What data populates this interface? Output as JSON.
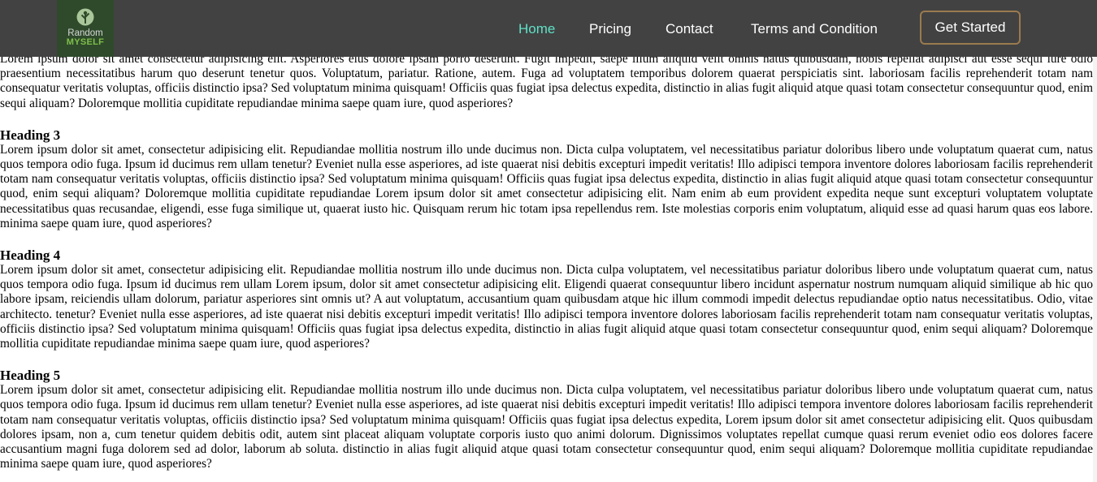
{
  "nav": {
    "logo_line1": "Random",
    "logo_line2": "MYSELF",
    "links": [
      "Home",
      "Pricing",
      "Contact",
      "Terms and Condition"
    ],
    "cta": "Get Started"
  },
  "content": {
    "intro": "Lorem ipsum dolor sit amet consectetur adipisicing elit. Asperiores eius dolore ipsam porro deserunt. Fugit impedit, saepe illum aliquid velit omnis natus quibusdam, nobis repellat adipisci aut esse sequi iure odio praesentium necessitatibus harum quo deserunt tenetur quos. Voluptatum, pariatur. Ratione, autem. Fuga ad voluptatem temporibus dolorem quaerat perspiciatis sint. laboriosam facilis reprehenderit totam nam consequatur veritatis voluptas, officiis distinctio ipsa? Sed voluptatum minima quisquam! Officiis quas fugiat ipsa delectus expedita, distinctio in alias fugit aliquid atque quasi totam consectetur consequuntur quod, enim sequi aliquam? Doloremque mollitia cupiditate repudiandae minima saepe quam iure, quod asperiores?",
    "sections": [
      {
        "heading": "Heading 3",
        "body": "Lorem ipsum dolor sit amet, consectetur adipisicing elit. Repudiandae mollitia nostrum illo unde ducimus non. Dicta culpa voluptatem, vel necessitatibus pariatur doloribus libero unde voluptatum quaerat cum, natus quos tempora odio fuga. Ipsum id ducimus rem ullam tenetur? Eveniet nulla esse asperiores, ad iste quaerat nisi debitis excepturi impedit veritatis! Illo adipisci tempora inventore dolores laboriosam facilis reprehenderit totam nam consequatur veritatis voluptas, officiis distinctio ipsa? Sed voluptatum minima quisquam! Officiis quas fugiat ipsa delectus expedita, distinctio in alias fugit aliquid atque quasi totam consectetur consequuntur quod, enim sequi aliquam? Doloremque mollitia cupiditate repudiandae Lorem ipsum dolor sit amet consectetur adipisicing elit. Nam enim ab eum provident expedita neque sunt excepturi voluptatem voluptate necessitatibus quas recusandae, eligendi, esse fuga similique ut, quaerat iusto hic. Quisquam rerum hic totam ipsa repellendus rem. Iste molestias corporis enim voluptatum, aliquid esse ad quasi harum quas eos labore. minima saepe quam iure, quod asperiores?"
      },
      {
        "heading": "Heading 4",
        "body": "Lorem ipsum dolor sit amet, consectetur adipisicing elit. Repudiandae mollitia nostrum illo unde ducimus non. Dicta culpa voluptatem, vel necessitatibus pariatur doloribus libero unde voluptatum quaerat cum, natus quos tempora odio fuga. Ipsum id ducimus rem ullam Lorem ipsum, dolor sit amet consectetur adipisicing elit. Eligendi quaerat consequuntur libero incidunt aspernatur nostrum numquam aliquid similique ab hic quo labore ipsam, reiciendis ullam dolorum, pariatur asperiores sint omnis ut? A aut voluptatum, accusantium quam quibusdam atque hic illum commodi impedit delectus repudiandae optio natus necessitatibus. Odio, vitae architecto. tenetur? Eveniet nulla esse asperiores, ad iste quaerat nisi debitis excepturi impedit veritatis! Illo adipisci tempora inventore dolores laboriosam facilis reprehenderit totam nam consequatur veritatis voluptas, officiis distinctio ipsa? Sed voluptatum minima quisquam! Officiis quas fugiat ipsa delectus expedita, distinctio in alias fugit aliquid atque quasi totam consectetur consequuntur quod, enim sequi aliquam? Doloremque mollitia cupiditate repudiandae minima saepe quam iure, quod asperiores?"
      },
      {
        "heading": "Heading 5",
        "body": "Lorem ipsum dolor sit amet, consectetur adipisicing elit. Repudiandae mollitia nostrum illo unde ducimus non. Dicta culpa voluptatem, vel necessitatibus pariatur doloribus libero unde voluptatum quaerat cum, natus quos tempora odio fuga. Ipsum id ducimus rem ullam tenetur? Eveniet nulla esse asperiores, ad iste quaerat nisi debitis excepturi impedit veritatis! Illo adipisci tempora inventore dolores laboriosam facilis reprehenderit totam nam consequatur veritatis voluptas, officiis distinctio ipsa? Sed voluptatum minima quisquam! Officiis quas fugiat ipsa delectus expedita, Lorem ipsum dolor sit amet consectetur adipisicing elit. Quos quibusdam dolores ipsam, non a, cum tenetur quidem debitis odit, autem sint placeat aliquam voluptate corporis iusto quo animi dolorum. Dignissimos voluptates repellat cumque quasi rerum eveniet odio eos dolores facere accusantium magni fuga dolorem sed ad dolor, laborum ab soluta. distinctio in alias fugit aliquid atque quasi totam consectetur consequuntur quod, enim sequi aliquam? Doloremque mollitia cupiditate repudiandae minima saepe quam iure, quod asperiores?"
      }
    ]
  }
}
